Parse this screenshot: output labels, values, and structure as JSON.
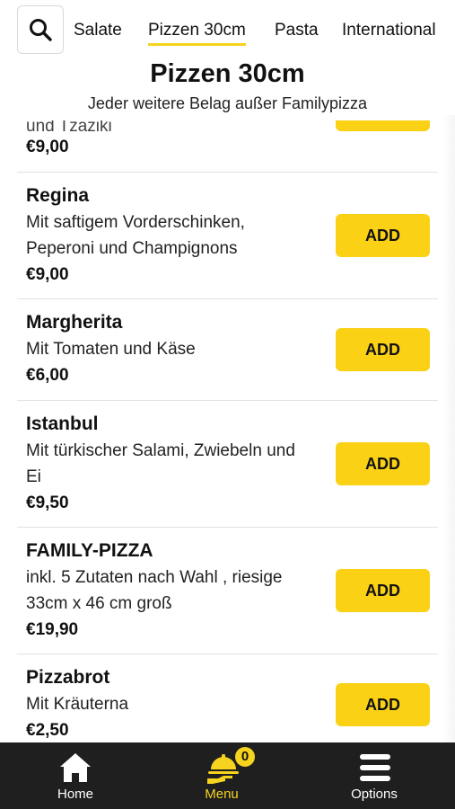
{
  "tabs": [
    {
      "label": "Salate"
    },
    {
      "label": "Pizzen 30cm",
      "active": true
    },
    {
      "label": "Pasta"
    },
    {
      "label": "International"
    }
  ],
  "section": {
    "title": "Pizzen 30cm",
    "subtitle": "Jeder weitere Belag außer Familypizza"
  },
  "items": [
    {
      "name": "",
      "desc_partial": "und Tzaziki",
      "price": "€9,00"
    },
    {
      "name": "Regina",
      "desc": [
        "Mit saftigem Vorderschinken,",
        "Peperoni und Champignons"
      ],
      "price": "€9,00",
      "add_label": "ADD"
    },
    {
      "name": "Margherita",
      "desc": [
        "Mit Tomaten und Käse"
      ],
      "price": "€6,00",
      "add_label": "ADD"
    },
    {
      "name": "Istanbul",
      "desc": [
        "Mit türkischer Salami, Zwiebeln und",
        "Ei"
      ],
      "price": "€9,50",
      "add_label": "ADD"
    },
    {
      "name": "FAMILY-PIZZA",
      "desc": [
        "inkl. 5 Zutaten nach Wahl , riesige",
        "33cm x 46 cm groß"
      ],
      "price": "€19,90",
      "add_label": "ADD"
    },
    {
      "name": "Pizzabrot",
      "desc": [
        "Mit Kräuterna"
      ],
      "price": "€2,50",
      "add_label": "ADD"
    }
  ],
  "nav": {
    "home": "Home",
    "menu": "Menu",
    "menu_badge": "0",
    "options": "Options"
  },
  "colors": {
    "accent": "#fbd116",
    "nav_bg": "#1f1f1f"
  },
  "icons": {
    "search": "search-icon",
    "home": "home-icon",
    "menu": "cloche-icon",
    "options": "hamburger-icon"
  }
}
